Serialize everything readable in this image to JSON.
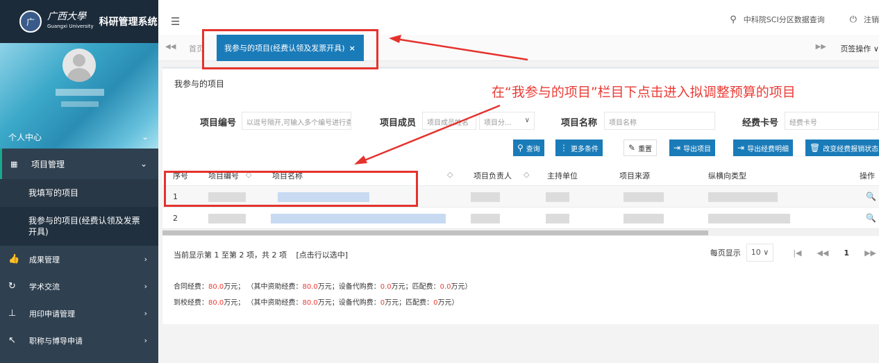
{
  "sidebar": {
    "logo_mark": "广",
    "logo_script": "广西大學",
    "logo_sub": "Guangxi University",
    "system_title": "科研管理系统",
    "personal_center": "个人中心",
    "active_menu": {
      "icon": "grid-icon",
      "label": "项目管理"
    },
    "submenu": [
      "我填写的项目",
      "我参与的项目(经费认领及发票开具)"
    ],
    "menu_items": [
      {
        "icon": "thumbs-up-icon",
        "label": "成果管理"
      },
      {
        "icon": "refresh-icon",
        "label": "学术交流"
      },
      {
        "icon": "stamp-icon",
        "label": "用印申请管理"
      },
      {
        "icon": "arrow-icon",
        "label": "职称与博导申请"
      }
    ]
  },
  "topbar": {
    "sci_query": "中科院SCI分区数据查询",
    "logout": "注销"
  },
  "tabs": {
    "home": "首页",
    "active": "我参与的项目(经费认领及发票开具)",
    "close": "×",
    "page_ops": "页签操作 ∨"
  },
  "panel": {
    "title": "我参与的项目",
    "annotation": "在“我参与的项目”栏目下点击进入拟调整预算的项目"
  },
  "filters": {
    "project_no_label": "项目编号",
    "project_no_placeholder": "以逗号隔开,可输入多个编号进行查询",
    "member_label": "项目成员",
    "member_placeholder": "项目成员姓名",
    "category_placeholder": "项目分...",
    "name_label": "项目名称",
    "name_placeholder": "项目名称",
    "card_label": "经费卡号",
    "card_placeholder": "经费卡号"
  },
  "buttons": {
    "query": "查询",
    "more": "更多条件",
    "reset": "重置",
    "export_projects": "导出项目",
    "export_fund_detail": "导出经费明细",
    "change_fund": "改变经费报销状态"
  },
  "table": {
    "headers": [
      "序号",
      "项目编号",
      "项目名称",
      "项目负责人",
      "主持单位",
      "项目来源",
      "纵横向类型",
      "操作"
    ],
    "rows": [
      {
        "no": "1"
      },
      {
        "no": "2"
      }
    ]
  },
  "pager": {
    "info": "当前显示第 1 至第 2 项，共 2 项",
    "select_hint": "[点击行以选中]",
    "per_page_label": "每页显示",
    "per_page": "10",
    "current_page": "1"
  },
  "fund": {
    "contract_label": "合同经费：",
    "contract_amount": "80.0",
    "unit": "万元；",
    "contract_inner": "（其中资助经费：",
    "contract_funding": "80.0",
    "equip_label": "万元；设备代购费：",
    "contract_equip": "0.0",
    "match_label": "万元；匹配费：",
    "contract_match": "0.0",
    "end": "万元）",
    "arrived_label": "到校经费：",
    "arrived_amount": "80.0",
    "arrived_funding": "80.0",
    "arrived_equip": "0",
    "arrived_match": "0"
  },
  "colors": {
    "primary": "#1a7bb9",
    "sidebar": "#2f4050",
    "annotation": "#ea3b35"
  }
}
